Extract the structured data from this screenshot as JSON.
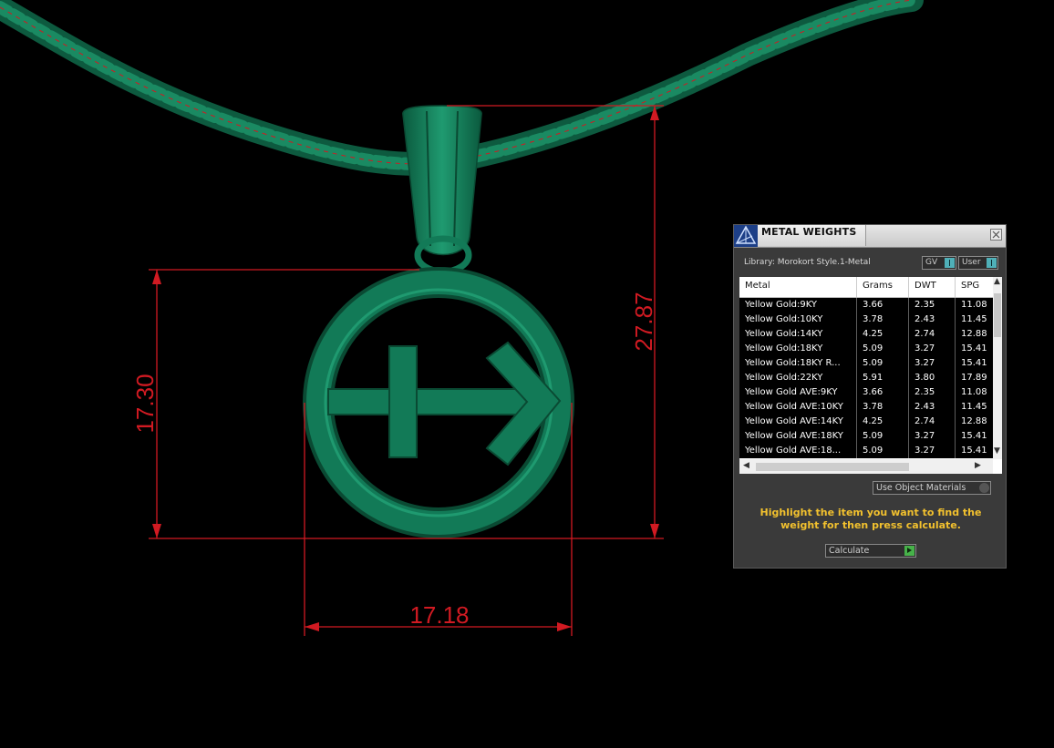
{
  "viewport": {
    "dimensions": {
      "width_label": "17.18",
      "height_label": "17.30",
      "total_height_label": "27.87"
    },
    "colors": {
      "model": "#127a57",
      "model_dark": "#0a4a33",
      "dimension": "#d11a22"
    }
  },
  "panel": {
    "title": "METAL WEIGHTS",
    "library_label": "Library: Morokort Style.1-Metal",
    "toggles": {
      "gv": "GV",
      "user": "User"
    },
    "table": {
      "columns": [
        "Metal",
        "Grams",
        "DWT",
        "SPG"
      ],
      "rows": [
        {
          "metal": "Yellow Gold:9KY",
          "grams": "3.66",
          "dwt": "2.35",
          "spg": "11.08"
        },
        {
          "metal": "Yellow Gold:10KY",
          "grams": "3.78",
          "dwt": "2.43",
          "spg": "11.45"
        },
        {
          "metal": "Yellow Gold:14KY",
          "grams": "4.25",
          "dwt": "2.74",
          "spg": "12.88"
        },
        {
          "metal": "Yellow Gold:18KY",
          "grams": "5.09",
          "dwt": "3.27",
          "spg": "15.41"
        },
        {
          "metal": "Yellow Gold:18KY R...",
          "grams": "5.09",
          "dwt": "3.27",
          "spg": "15.41"
        },
        {
          "metal": "Yellow Gold:22KY",
          "grams": "5.91",
          "dwt": "3.80",
          "spg": "17.89"
        },
        {
          "metal": "Yellow Gold AVE:9KY",
          "grams": "3.66",
          "dwt": "2.35",
          "spg": "11.08"
        },
        {
          "metal": "Yellow Gold AVE:10KY",
          "grams": "3.78",
          "dwt": "2.43",
          "spg": "11.45"
        },
        {
          "metal": "Yellow Gold AVE:14KY",
          "grams": "4.25",
          "dwt": "2.74",
          "spg": "12.88"
        },
        {
          "metal": "Yellow Gold AVE:18KY",
          "grams": "5.09",
          "dwt": "3.27",
          "spg": "15.41"
        },
        {
          "metal": "Yellow Gold AVE:18...",
          "grams": "5.09",
          "dwt": "3.27",
          "spg": "15.41"
        }
      ]
    },
    "use_object_materials": "Use Object Materials",
    "hint": "Highlight the item you want to find the weight for then press calculate.",
    "calculate": "Calculate",
    "hint_color": "#f2c12e"
  }
}
